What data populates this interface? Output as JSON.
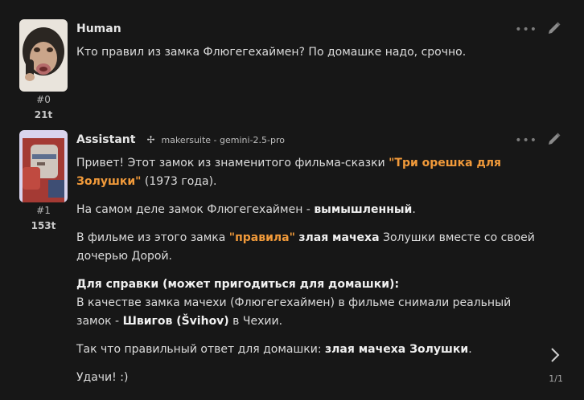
{
  "messages": [
    {
      "author": "Human",
      "index": "#0",
      "tokens": "21t",
      "text": "Кто правил из замка Флюгегехаймен? По домашке надо, срочно."
    },
    {
      "author": "Assistant",
      "index": "#1",
      "tokens": "153t",
      "model_icon": "✢",
      "model": "makersuite - gemini-2.5-pro",
      "p1_a": "Привет! Этот замок из знаменитого фильма-сказки ",
      "p1_hl": "\"Три орешка для Золушки\"",
      "p1_b": " (1973 года).",
      "p2_a": "На самом деле замок Флюгегехаймен - ",
      "p2_bold": "вымышленный",
      "p2_b": ".",
      "p3_a": "В фильме из этого замка ",
      "p3_hl": "\"правила\"",
      "p3_sp": " ",
      "p3_bold": "злая мачеха",
      "p3_b": " Золушки вместе со своей дочерью Дорой.",
      "p4_heading": "Для справки (может пригодиться для домашки):",
      "p4_a": "В качестве замка мачехи (Флюгегехаймен) в фильме снимали реальный замок - ",
      "p4_bold": "Швигов (Švihov)",
      "p4_b": " в Чехии.",
      "p5_a": "Так что правильный ответ для домашки: ",
      "p5_bold": "злая мачеха Золушки",
      "p5_b": ".",
      "p6": "Удачи! :)"
    }
  ],
  "pager": "1/1",
  "icons": [
    "more-icon",
    "edit-icon",
    "next-icon",
    "model-icon"
  ],
  "colors": {
    "background": "#171717",
    "highlight": "#f19a3a",
    "text": "#dcdcdc"
  }
}
